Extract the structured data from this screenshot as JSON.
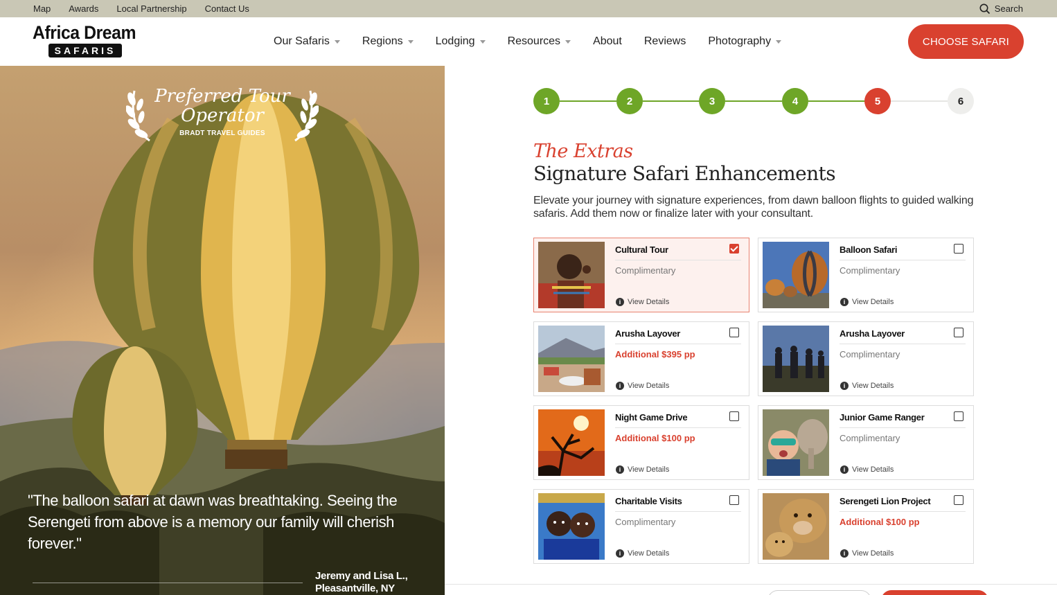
{
  "utility": {
    "links": [
      "Map",
      "Awards",
      "Local Partnership",
      "Contact Us"
    ],
    "search_label": "Search"
  },
  "brand": {
    "line1": "Africa Dream",
    "line2": "SAFARIS"
  },
  "nav": {
    "items": [
      {
        "label": "Our Safaris",
        "dropdown": true
      },
      {
        "label": "Regions",
        "dropdown": true
      },
      {
        "label": "Lodging",
        "dropdown": true
      },
      {
        "label": "Resources",
        "dropdown": true
      },
      {
        "label": "About",
        "dropdown": false
      },
      {
        "label": "Reviews",
        "dropdown": false
      },
      {
        "label": "Photography",
        "dropdown": true
      }
    ],
    "cta_label": "CHOOSE SAFARI"
  },
  "hero": {
    "award_line1": "Preferred Tour",
    "award_line2": "Operator",
    "award_source": "BRADT TRAVEL GUIDES",
    "quote": "\"The balloon safari at dawn was breathtaking. Seeing the Serengeti from above is a memory our family will cherish forever.\"",
    "author_line1": "Jeremy and Lisa L.,",
    "author_line2": "Pleasantville, NY"
  },
  "stepper": {
    "steps": [
      "1",
      "2",
      "3",
      "4",
      "5",
      "6"
    ],
    "current_step": 5
  },
  "section": {
    "eyebrow": "The Extras",
    "title": "Signature Safari Enhancements",
    "description": "Elevate your journey with signature experiences, from dawn balloon flights to guided walking safaris. Add them now or finalize later with your consultant."
  },
  "extras": [
    {
      "name": "Cultural Tour",
      "price": "Complimentary",
      "additional": false,
      "checked": true,
      "details": "View Details",
      "thumb": "maasai-portrait"
    },
    {
      "name": "Balloon Safari",
      "price": "Complimentary",
      "additional": false,
      "checked": false,
      "details": "View Details",
      "thumb": "hot-air-balloons"
    },
    {
      "name": "Arusha Layover",
      "price": "Additional $395 pp",
      "additional": true,
      "checked": false,
      "details": "View Details",
      "thumb": "lodge-terrace-mountain"
    },
    {
      "name": "Arusha Layover",
      "price": "Complimentary",
      "additional": false,
      "checked": false,
      "details": "View Details",
      "thumb": "walking-group"
    },
    {
      "name": "Night Game Drive",
      "price": "Additional $100 pp",
      "additional": true,
      "checked": false,
      "details": "View Details",
      "thumb": "sunset-tree"
    },
    {
      "name": "Junior Game Ranger",
      "price": "Complimentary",
      "additional": false,
      "checked": false,
      "details": "View Details",
      "thumb": "child-elephant"
    },
    {
      "name": "Charitable Visits",
      "price": "Complimentary",
      "additional": false,
      "checked": false,
      "details": "View Details",
      "thumb": "school-children"
    },
    {
      "name": "Serengeti Lion Project",
      "price": "Additional $100 pp",
      "additional": true,
      "checked": false,
      "details": "View Details",
      "thumb": "lioness-cub"
    }
  ],
  "colors": {
    "accent": "#d9412f",
    "complete": "#6ea627",
    "utility_bar": "#c9c7b5"
  }
}
